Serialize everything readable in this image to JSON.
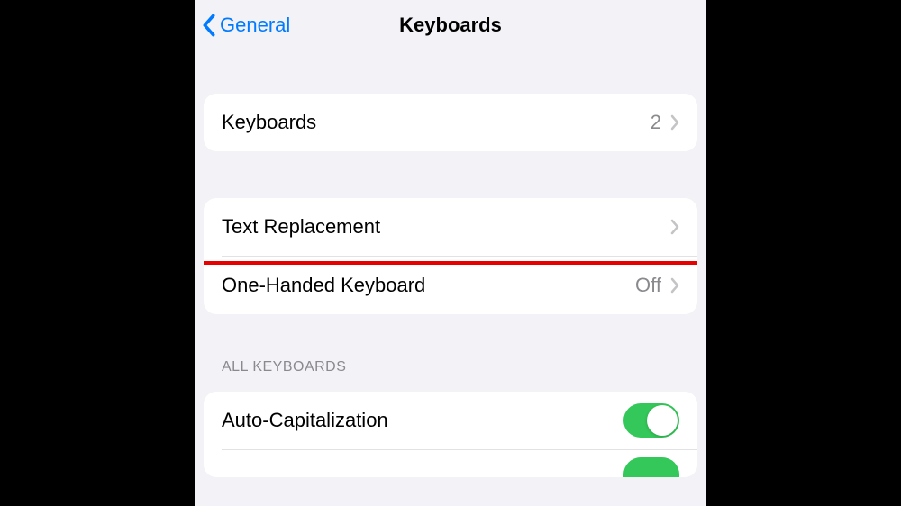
{
  "nav": {
    "back_label": "General",
    "title": "Keyboards"
  },
  "group1": {
    "keyboards_label": "Keyboards",
    "keyboards_count": "2"
  },
  "group2": {
    "text_replacement_label": "Text Replacement",
    "one_handed_label": "One-Handed Keyboard",
    "one_handed_value": "Off"
  },
  "section": {
    "all_keyboards_header": "ALL KEYBOARDS",
    "auto_cap_label": "Auto-Capitalization"
  },
  "colors": {
    "accent": "#007aff",
    "toggle_on": "#34c759",
    "highlight": "#e60000"
  }
}
